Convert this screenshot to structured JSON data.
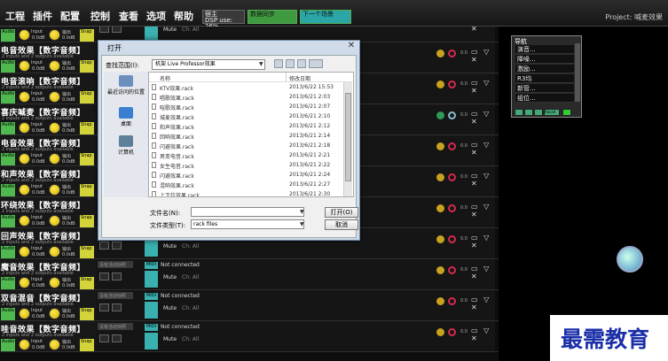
{
  "menu": [
    "工程",
    "插件",
    "配置",
    "控制",
    "查看",
    "选项",
    "帮助"
  ],
  "status": {
    "cpu_label": "宿主",
    "dsp_use": "DSP use: 26%",
    "box2": "数据同步",
    "box3": "下一个场景"
  },
  "project": "Project: 喊麦效果",
  "rack": {
    "row_sub": "2 inputs and 2 outputs available",
    "audio_tag": "Audio",
    "input_label": "Input",
    "db": "0.0dB",
    "output_label": "输出",
    "snap_label": "Snap",
    "row_tab": "没有活动快照",
    "midi_tag": "MIDI",
    "not_connected": "Not connected",
    "mute": "Mute",
    "ch_all": "Ch: All",
    "vol": "0.0",
    "rows": [
      {
        "title": ""
      },
      {
        "title": "电音效果【数字音频】"
      },
      {
        "title": "电音滚响【数字音频】"
      },
      {
        "title": "喜庆喊麦【数字音频】"
      },
      {
        "title": "电音效果【数字音频】"
      },
      {
        "title": "和声效果【数字音频】"
      },
      {
        "title": "环绕效果【数字音频】"
      },
      {
        "title": "回声效果【数字音频】"
      },
      {
        "title": "魔音效果【数字音频】"
      },
      {
        "title": "双音混音【数字音频】"
      },
      {
        "title": "哇音效果【数字音频】"
      }
    ]
  },
  "nav": {
    "title": "导航",
    "items": [
      "演音...",
      "降噪...",
      "激励...",
      "R3均",
      "新管...",
      "组位..."
    ],
    "tool_label": "Recall"
  },
  "dialog": {
    "title": "打开",
    "close": "✕",
    "lookin_label": "查找范围(I):",
    "lookin_value": "机架 Live Professor效果",
    "places": [
      "最近访问的位置",
      "桌面",
      "计算机"
    ],
    "col_name": "名称",
    "col_date": "修改日期",
    "files": [
      {
        "name": "KTV效果.rack",
        "date": "2013/6/22 15:53"
      },
      {
        "name": "唱歌效果.rack",
        "date": "2013/6/21 2:03"
      },
      {
        "name": "喧歌效果.rack",
        "date": "2013/6/21 2:07"
      },
      {
        "name": "城麦效果.rack",
        "date": "2013/6/21 2:10"
      },
      {
        "name": "和声效果.rack",
        "date": "2013/6/21 2:12"
      },
      {
        "name": "回响效果.rack",
        "date": "2013/6/21 2:14"
      },
      {
        "name": "闪避效果.rack",
        "date": "2013/6/21 2:18"
      },
      {
        "name": "男变电音.rack",
        "date": "2013/6/21 2:21"
      },
      {
        "name": "女生电音.rack",
        "date": "2013/6/21 2:22"
      },
      {
        "name": "闪避效果.rack",
        "date": "2013/6/21 2:24"
      },
      {
        "name": "混响效果.rack",
        "date": "2013/6/21 2:27"
      },
      {
        "name": "上下位效果.rack",
        "date": "2013/6/21 2:30"
      }
    ],
    "filename_label": "文件名(N):",
    "filename_value": "",
    "filetype_label": "文件类型(T):",
    "filetype_value": "rack files",
    "open_button": "打开(O)",
    "cancel_button": "取消"
  },
  "watermark": "最需教育"
}
